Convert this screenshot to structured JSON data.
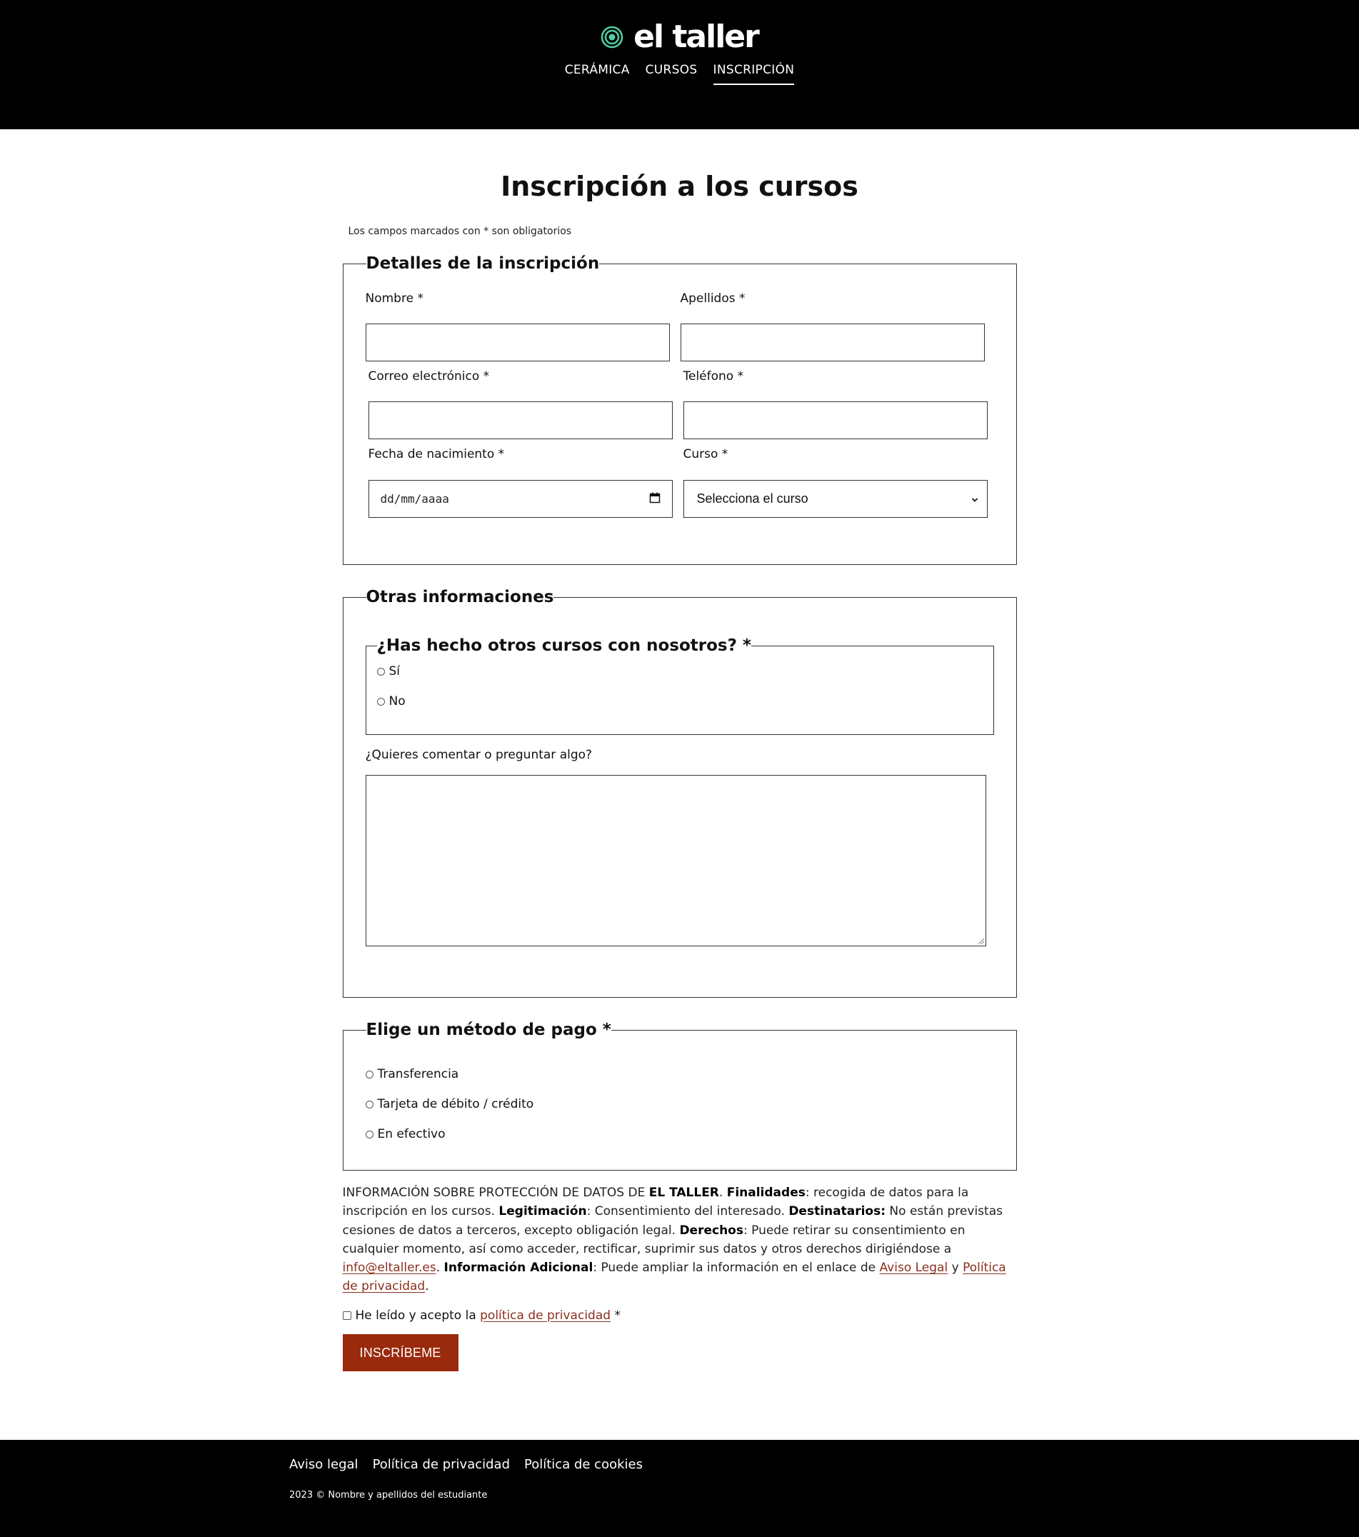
{
  "header": {
    "brand_name": "el taller",
    "logo_icon": "concentric-circles-icon",
    "logo_color": "#4fd1a5",
    "nav": [
      {
        "label": "CERÁMICA",
        "active": false
      },
      {
        "label": "CURSOS",
        "active": false
      },
      {
        "label": "INSCRIPCIÓN",
        "active": true
      }
    ]
  },
  "main": {
    "title": "Inscripción a los cursos",
    "required_note": "Los campos marcados con * son obligatorios"
  },
  "details": {
    "legend": "Detalles de la inscripción",
    "nombre_label": "Nombre *",
    "nombre_value": "",
    "apellidos_label": "Apellidos *",
    "apellidos_value": "",
    "email_label": "Correo electrónico *",
    "email_value": "",
    "telefono_label": "Teléfono *",
    "telefono_value": "",
    "fecha_label": "Fecha de nacimiento *",
    "fecha_placeholder": "dd/mm/aaaa",
    "curso_label": "Curso *",
    "curso_selected": "Selecciona el curso"
  },
  "other": {
    "legend": "Otras informaciones",
    "question_legend": "¿Has hecho otros cursos con nosotros? *",
    "options": [
      "Sí",
      "No"
    ],
    "comment_label": "¿Quieres comentar o preguntar algo?",
    "comment_value": ""
  },
  "payment": {
    "legend": "Elige un método de pago *",
    "options": [
      "Transferencia",
      "Tarjeta de débito / crédito",
      "En efectivo"
    ]
  },
  "privacy": {
    "p1": "INFORMACIÓN SOBRE PROTECCIÓN DE DATOS DE ",
    "b1": "EL TALLER",
    "p2": ". ",
    "b2": "Finalidades",
    "p3": ": recogida de datos para la inscripción en los cursos. ",
    "b3": "Legitimación",
    "p4": ": Consentimiento del interesado. ",
    "b4": "Destinatarios:",
    "p5": " No están previstas cesiones de datos a terceros, excepto obligación legal. ",
    "b5": "Derechos",
    "p6": ": Puede retirar su consentimiento en cualquier momento, así como acceder, rectificar, suprimir sus datos y otros derechos dirigiéndose a ",
    "email_link": "info@eltaller.es",
    "p7": ". ",
    "b6": "Información Adicional",
    "p8": ": Puede ampliar la información en el enlace de ",
    "aviso_link": "Aviso Legal",
    "p9": " y ",
    "politica_link": "Política de privacidad",
    "p10": ".",
    "link_color": "#8b2f1c"
  },
  "accept": {
    "text_before": "He leído y acepto la ",
    "link": "política de privacidad",
    "text_after": " *"
  },
  "submit": {
    "label": "INSCRÍBEME",
    "color": "#9a2a0e"
  },
  "footer": {
    "links": [
      "Aviso legal",
      "Política de privacidad",
      "Política de cookies"
    ],
    "copyright": "2023 © Nombre y apellidos del estudiante"
  }
}
